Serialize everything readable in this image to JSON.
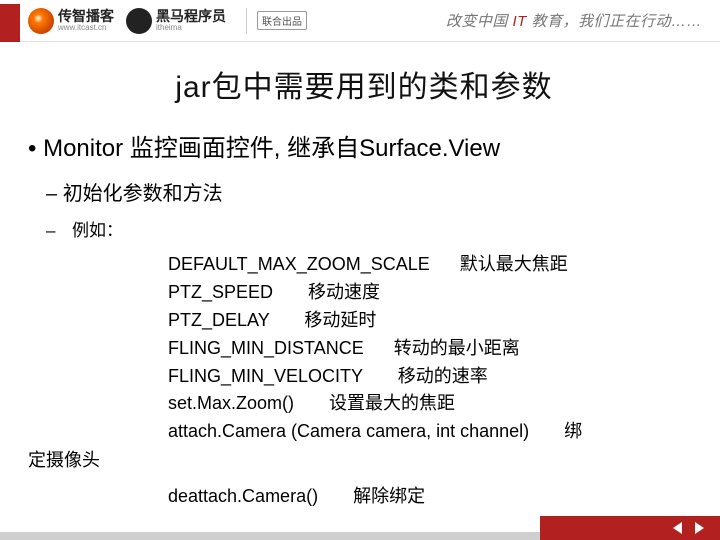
{
  "header": {
    "logo1_name": "传智播客",
    "logo1_url": "www.itcast.cn",
    "logo2_name": "黑马程序员",
    "logo2_url": "itheima",
    "joint": "联合出品",
    "slogan_pre": "改变中国 ",
    "slogan_hl": "IT",
    "slogan_post": " 教育，我们正在行动……"
  },
  "title": "jar包中需要用到的类和参数",
  "bullet1": "Monitor 监控画面控件, 继承自Surface.View",
  "bullet2": "初始化参数和方法",
  "bullet3": "例如：",
  "code": {
    "l1": "DEFAULT_MAX_ZOOM_SCALE      默认最大焦距",
    "l2": "PTZ_SPEED       移动速度",
    "l3": "PTZ_DELAY       移动延时",
    "l4": "FLING_MIN_DISTANCE      转动的最小距离",
    "l5": "FLING_MIN_VELOCITY       移动的速率",
    "l6": "set.Max.Zoom()       设置最大的焦距",
    "l7": "attach.Camera (Camera camera, int channel)       绑"
  },
  "tail": "定摄像头",
  "after": "deattach.Camera()       解除绑定"
}
